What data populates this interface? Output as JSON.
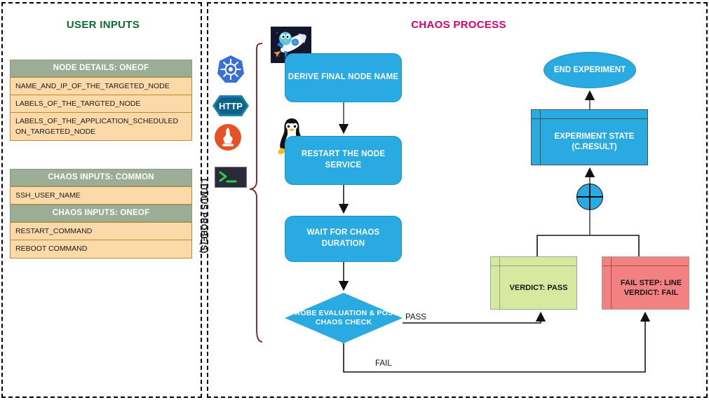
{
  "left_panel": {
    "title": "USER INPUTS",
    "tables": [
      {
        "header": "NODE DETAILS: ONEOF",
        "rows": [
          "NAME_AND_IP_OF_THE_TARGETED_NODE",
          "LABELS_OF_THE_TARGTED_NODE",
          "LABELS_OF_THE_APPLICATION_SCHEDULED ON_TARGETED_NODE"
        ]
      },
      {
        "header": "CHAOS INPUTS: COMMON",
        "rows": [
          "SSH_USER_NAME"
        ],
        "header2": "CHAOS INPUTS: ONEOF",
        "rows2": [
          "RESTART_COMMAND",
          "REBOOT COMMAND"
        ]
      }
    ]
  },
  "right_panel": {
    "title": "CHAOS PROCESS",
    "brace_label": "LITMUS PROBE(S)",
    "probe_icons": [
      {
        "name": "kubernetes-icon",
        "label": ""
      },
      {
        "name": "http-icon",
        "label": "HTTP"
      },
      {
        "name": "prometheus-icon",
        "label": ""
      },
      {
        "name": "command-terminal-icon",
        "label": ""
      }
    ],
    "nodes": {
      "derive": "DERIVE FINAL NODE NAME",
      "restart": "RESTART THE  NODE SERVICE",
      "wait": "WAIT FOR CHAOS DURATION",
      "probe_check": "PROBE EVALUATION & POST CHAOS CHECK",
      "end": "END EXPERIMENT",
      "state": "EXPERIMENT STATE (C.RESULT)",
      "verdict_pass": "VERDICT: PASS",
      "verdict_fail": "FAIL STEP: LINE VERDICT: FAIL"
    },
    "edges": {
      "pass": "PASS",
      "fail": "FAIL"
    }
  },
  "colors": {
    "process_blue": "#29aae1",
    "title_green": "#0c6b35",
    "title_pink": "#d6006e",
    "table_header_green": "#9cad95",
    "table_row_peach": "#fbd9a8",
    "verdict_pass_green": "#d5ea9e",
    "verdict_fail_red": "#f48181",
    "brace_maroon": "#7a1a22"
  }
}
